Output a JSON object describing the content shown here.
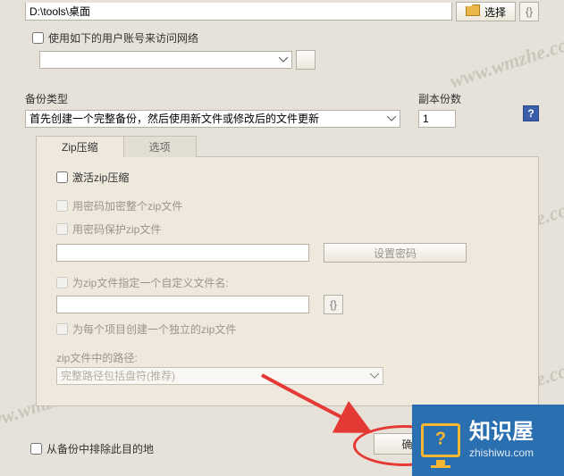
{
  "path_value": "D:\\tools\\桌面",
  "select_btn": "选择",
  "use_net_account": "使用如下的用户账号来访问网络",
  "backup_type_label": "备份类型",
  "backup_type_value": "首先创建一个完整备份，然后使用新文件或修改后的文件更新",
  "copies_label": "副本份数",
  "copies_value": "1",
  "tabs": {
    "zip": "Zip压缩",
    "options": "选项"
  },
  "zip": {
    "activate": "激活zip压缩",
    "pwd_encrypt": "用密码加密整个zip文件",
    "pwd_protect": "用密码保护zip文件",
    "set_pwd": "设置密码",
    "custom_name": "为zip文件指定一个自定义文件名:",
    "per_item": "为每个项目创建一个独立的zip文件",
    "path_in_zip_label": "zip文件中的路径:",
    "path_in_zip_value": "完整路径包括盘符(推荐)"
  },
  "exclude_dest": "从备份中排除此目的地",
  "ok": "确",
  "brand": {
    "zh": "知识屋",
    "url": "zhishiwu.com"
  },
  "watermark": "www.wmzhe.com"
}
